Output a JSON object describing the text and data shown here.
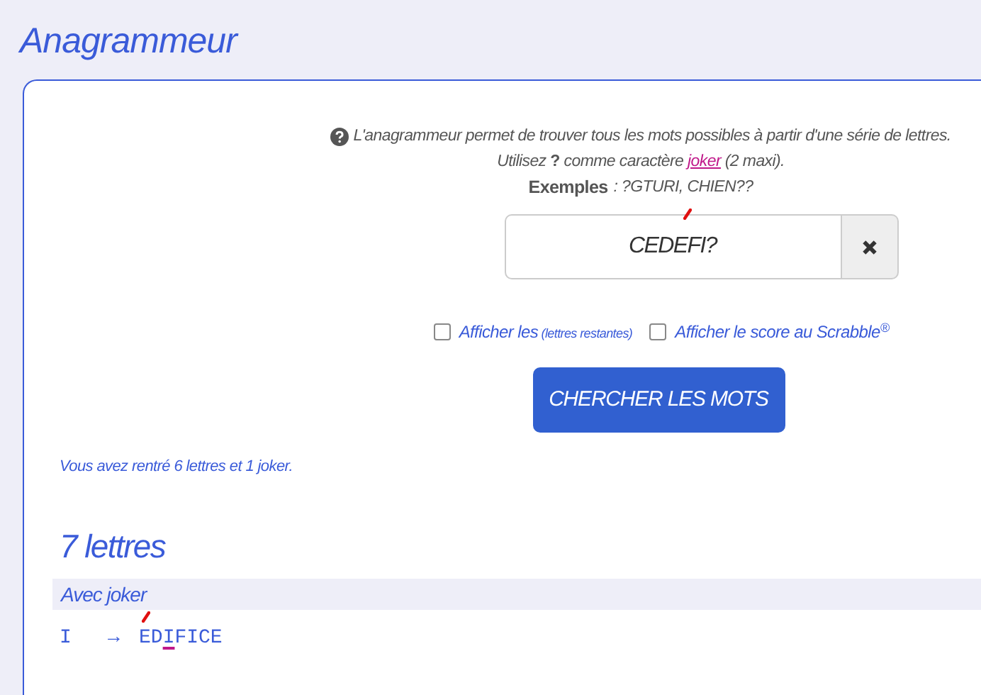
{
  "title": "Anagrammeur",
  "help": {
    "line1": "L'anagrammeur permet de trouver tous les mots possibles à partir d'une série de lettres.",
    "line2_before": "Utilisez",
    "joker_char": "?",
    "line2_middle": "comme caractère",
    "joker_link": "joker",
    "line2_after": "(2 maxi).",
    "examples_label": "Exemples",
    "examples": ": ?GTURI, CHIEN??"
  },
  "search": {
    "value": "CEDEFI?"
  },
  "options": [
    {
      "label": "Afficher les",
      "small": "(lettres restantes)",
      "checked": false
    },
    {
      "label": "Afficher le score au Scrabble$^{®}$",
      "checked": false
    }
  ],
  "submit": "CHERCHER LES MOTS",
  "summary": "Vous avez rentré 6 lettres et 1 joker.",
  "sections": [
    {
      "heading": "7 lettres",
      "group": "Avec joker",
      "results": [
        {
          "joker": "I",
          "arrow": "→",
          "word_before": "ED",
          "word_joker": "I",
          "word_after": "FICE"
        }
      ]
    }
  ]
}
